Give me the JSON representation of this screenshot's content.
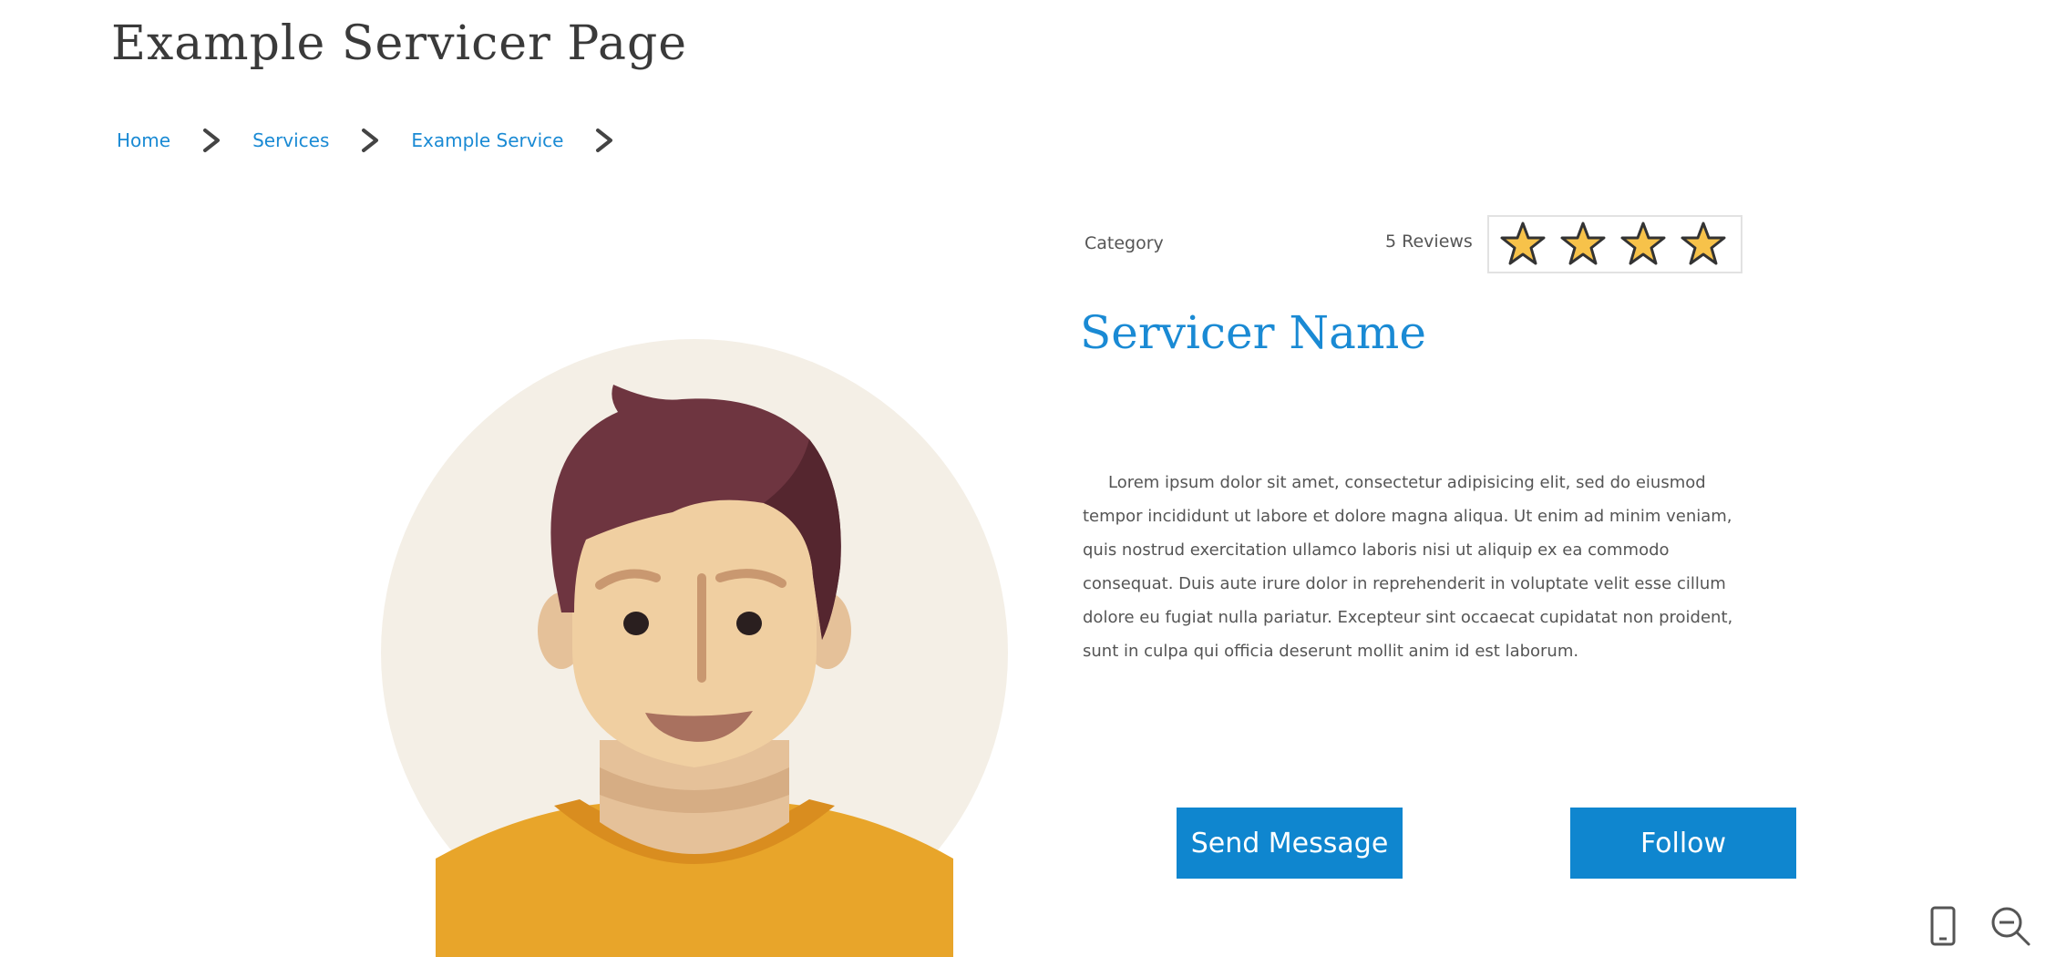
{
  "page": {
    "title": "Example Servicer Page"
  },
  "breadcrumb": {
    "items": [
      {
        "label": "Home"
      },
      {
        "label": "Services"
      },
      {
        "label": "Example Service"
      }
    ]
  },
  "servicer": {
    "category": "Category",
    "reviews_label": "5 Reviews",
    "rating": 4,
    "name": "Servicer Name",
    "description": "Lorem ipsum dolor sit amet, consectetur adipisicing elit, sed do eiusmod tempor incididunt ut labore et dolore magna aliqua. Ut enim ad minim veniam, quis nostrud exercitation ullamco laboris nisi ut aliquip ex ea commodo consequat. Duis aute irure dolor in reprehenderit in voluptate velit esse cillum dolore eu fugiat nulla pariatur. Excepteur sint occaecat cupidatat non proident, sunt in culpa qui officia deserunt mollit anim id est laborum."
  },
  "actions": {
    "send_message_label": "Send Message",
    "follow_label": "Follow"
  },
  "icons": {
    "breadcrumb_separator": "chevron-right-icon",
    "star": "star-icon",
    "device": "mobile-device-icon",
    "zoom": "zoom-out-icon"
  },
  "colors": {
    "accent": "#0f86cf",
    "link": "#1a8ad4",
    "star_fill": "#f7c24a",
    "avatar_bg": "#f4efe6"
  }
}
